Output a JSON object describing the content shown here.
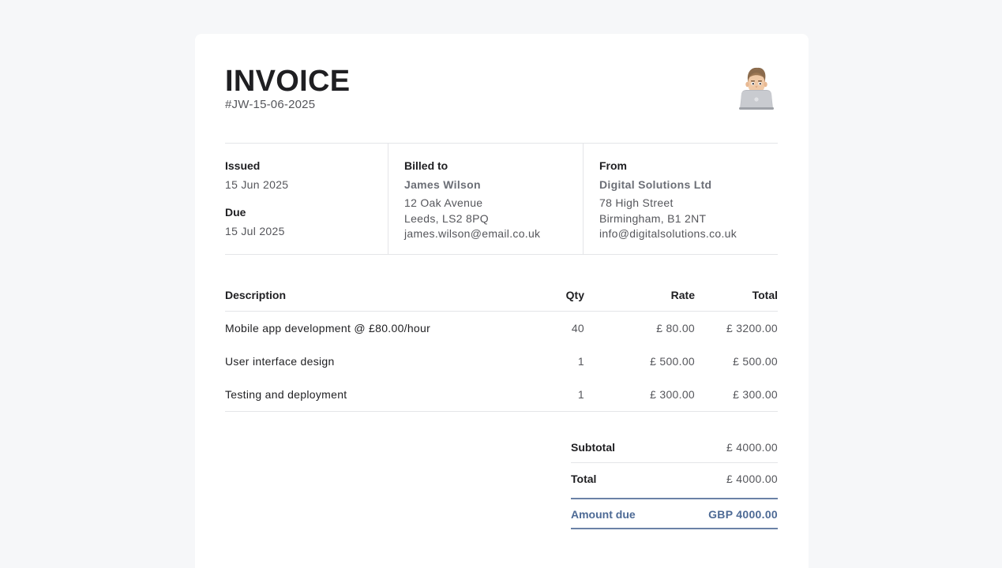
{
  "invoice": {
    "title": "INVOICE",
    "number": "#JW-15-06-2025"
  },
  "dates": {
    "issued_label": "Issued",
    "issued_value": "15 Jun 2025",
    "due_label": "Due",
    "due_value": "15 Jul 2025"
  },
  "billed_to": {
    "label": "Billed to",
    "name": "James Wilson",
    "address_line1": "12 Oak Avenue",
    "address_line2": "Leeds, LS2 8PQ",
    "email": "james.wilson@email.co.uk"
  },
  "from": {
    "label": "From",
    "name": "Digital Solutions Ltd",
    "address_line1": "78 High Street",
    "address_line2": "Birmingham, B1 2NT",
    "email": "info@digitalsolutions.co.uk"
  },
  "table": {
    "headers": {
      "description": "Description",
      "qty": "Qty",
      "rate": "Rate",
      "total": "Total"
    },
    "rows": [
      {
        "description": "Mobile app development @ £80.00/hour",
        "qty": "40",
        "rate": "£ 80.00",
        "total": "£ 3200.00"
      },
      {
        "description": "User interface design",
        "qty": "1",
        "rate": "£ 500.00",
        "total": "£ 500.00"
      },
      {
        "description": "Testing and deployment",
        "qty": "1",
        "rate": "£ 300.00",
        "total": "£ 300.00"
      }
    ]
  },
  "totals": {
    "subtotal_label": "Subtotal",
    "subtotal_value": "£ 4000.00",
    "total_label": "Total",
    "total_value": "£ 4000.00",
    "amount_due_label": "Amount due",
    "amount_due_value": "GBP 4000.00"
  },
  "avatar": {
    "icon": "memoji-laptop-avatar"
  },
  "colors": {
    "accent": "#4d6a95",
    "background": "#f6f7f9"
  }
}
